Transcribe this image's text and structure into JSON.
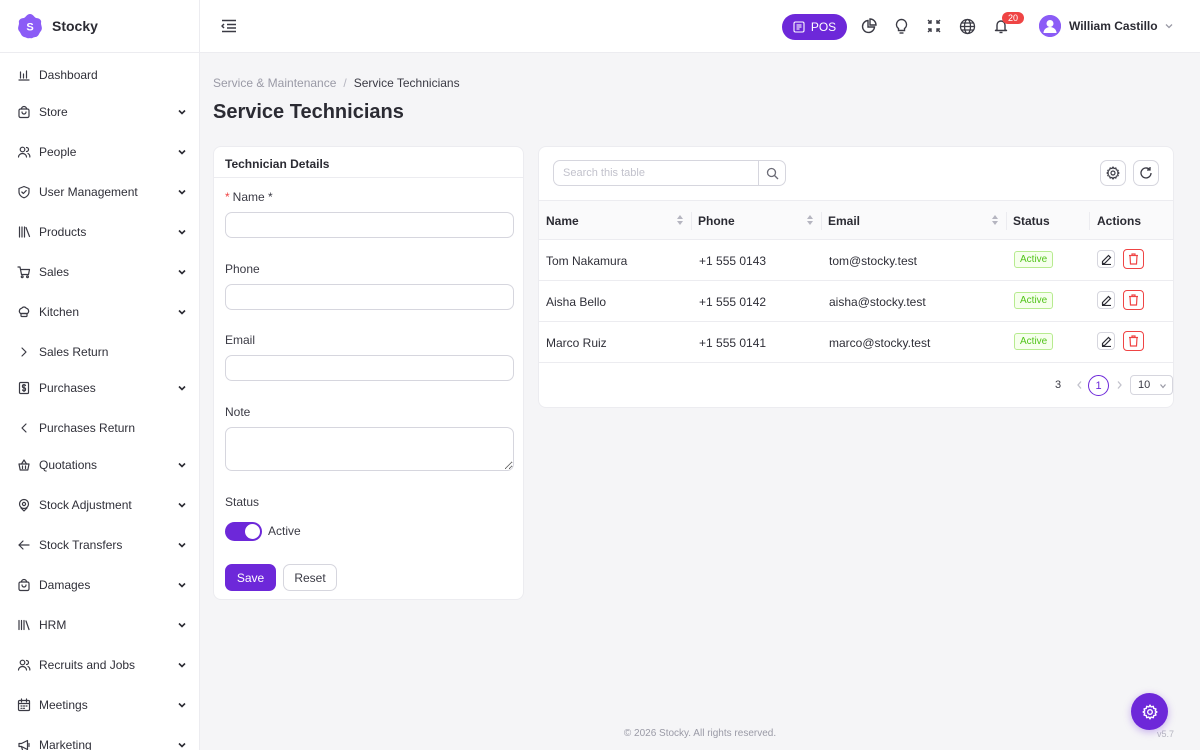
{
  "app": {
    "name": "Stocky",
    "logo_letter": "S"
  },
  "colors": {
    "accent": "#6d28d9",
    "danger": "#ef4444",
    "success": "#52c41a"
  },
  "sidebar": {
    "items": [
      {
        "label": "Dashboard",
        "icon": "bar-chart-icon",
        "chevron": "none"
      },
      {
        "label": "Store",
        "icon": "store-bag-icon",
        "chevron": "down"
      },
      {
        "label": "People",
        "icon": "people-icon",
        "chevron": "down"
      },
      {
        "label": "User Management",
        "icon": "shield-icon",
        "chevron": "down"
      },
      {
        "label": "Products",
        "icon": "books-icon",
        "chevron": "down"
      },
      {
        "label": "Sales",
        "icon": "cart-icon",
        "chevron": "down"
      },
      {
        "label": "Kitchen",
        "icon": "chef-hat-icon",
        "chevron": "down"
      },
      {
        "label": "Sales Return",
        "icon": "chevron-right-icon",
        "chevron": "none"
      },
      {
        "label": "Purchases",
        "icon": "receipt-icon",
        "chevron": "down"
      },
      {
        "label": "Purchases Return",
        "icon": "chevron-left-icon",
        "chevron": "none"
      },
      {
        "label": "Quotations",
        "icon": "basket-icon",
        "chevron": "down"
      },
      {
        "label": "Stock Adjustment",
        "icon": "target-icon",
        "chevron": "down"
      },
      {
        "label": "Stock Transfers",
        "icon": "arrow-left-icon",
        "chevron": "down"
      },
      {
        "label": "Damages",
        "icon": "bag-icon",
        "chevron": "down"
      },
      {
        "label": "HRM",
        "icon": "library-icon",
        "chevron": "down"
      },
      {
        "label": "Recruits and Jobs",
        "icon": "user-search-icon",
        "chevron": "down"
      },
      {
        "label": "Meetings",
        "icon": "calendar-icon",
        "chevron": "down"
      },
      {
        "label": "Marketing",
        "icon": "megaphone-icon",
        "chevron": "down"
      }
    ]
  },
  "header": {
    "pos_label": "POS",
    "notification_count": "20",
    "user_name": "William Castillo"
  },
  "breadcrumb": {
    "parent": "Service & Maintenance",
    "separator": "/",
    "current": "Service Technicians"
  },
  "page_title": "Service Technicians",
  "form": {
    "title": "Technician Details",
    "name_required_mark": "*",
    "name_label": "Name *",
    "name_value": "",
    "phone_label": "Phone",
    "phone_value": "",
    "email_label": "Email",
    "email_value": "",
    "note_label": "Note",
    "note_value": "",
    "status_label": "Status",
    "status_toggle_label": "Active",
    "status_on": true,
    "save_label": "Save",
    "reset_label": "Reset"
  },
  "table": {
    "search_placeholder": "Search this table",
    "columns": [
      "Name",
      "Phone",
      "Email",
      "Status",
      "Actions"
    ],
    "rows": [
      {
        "name": "Tom Nakamura",
        "phone": "+1 555 0143",
        "email": "tom@stocky.test",
        "status": "Active"
      },
      {
        "name": "Aisha Bello",
        "phone": "+1 555 0142",
        "email": "aisha@stocky.test",
        "status": "Active"
      },
      {
        "name": "Marco Ruiz",
        "phone": "+1 555 0141",
        "email": "marco@stocky.test",
        "status": "Active"
      }
    ],
    "pagination": {
      "total": "3",
      "current_page": "1",
      "page_size": "10"
    }
  },
  "footer": {
    "copyright": "© 2026 Stocky. All rights reserved.",
    "version": "v5.7"
  }
}
